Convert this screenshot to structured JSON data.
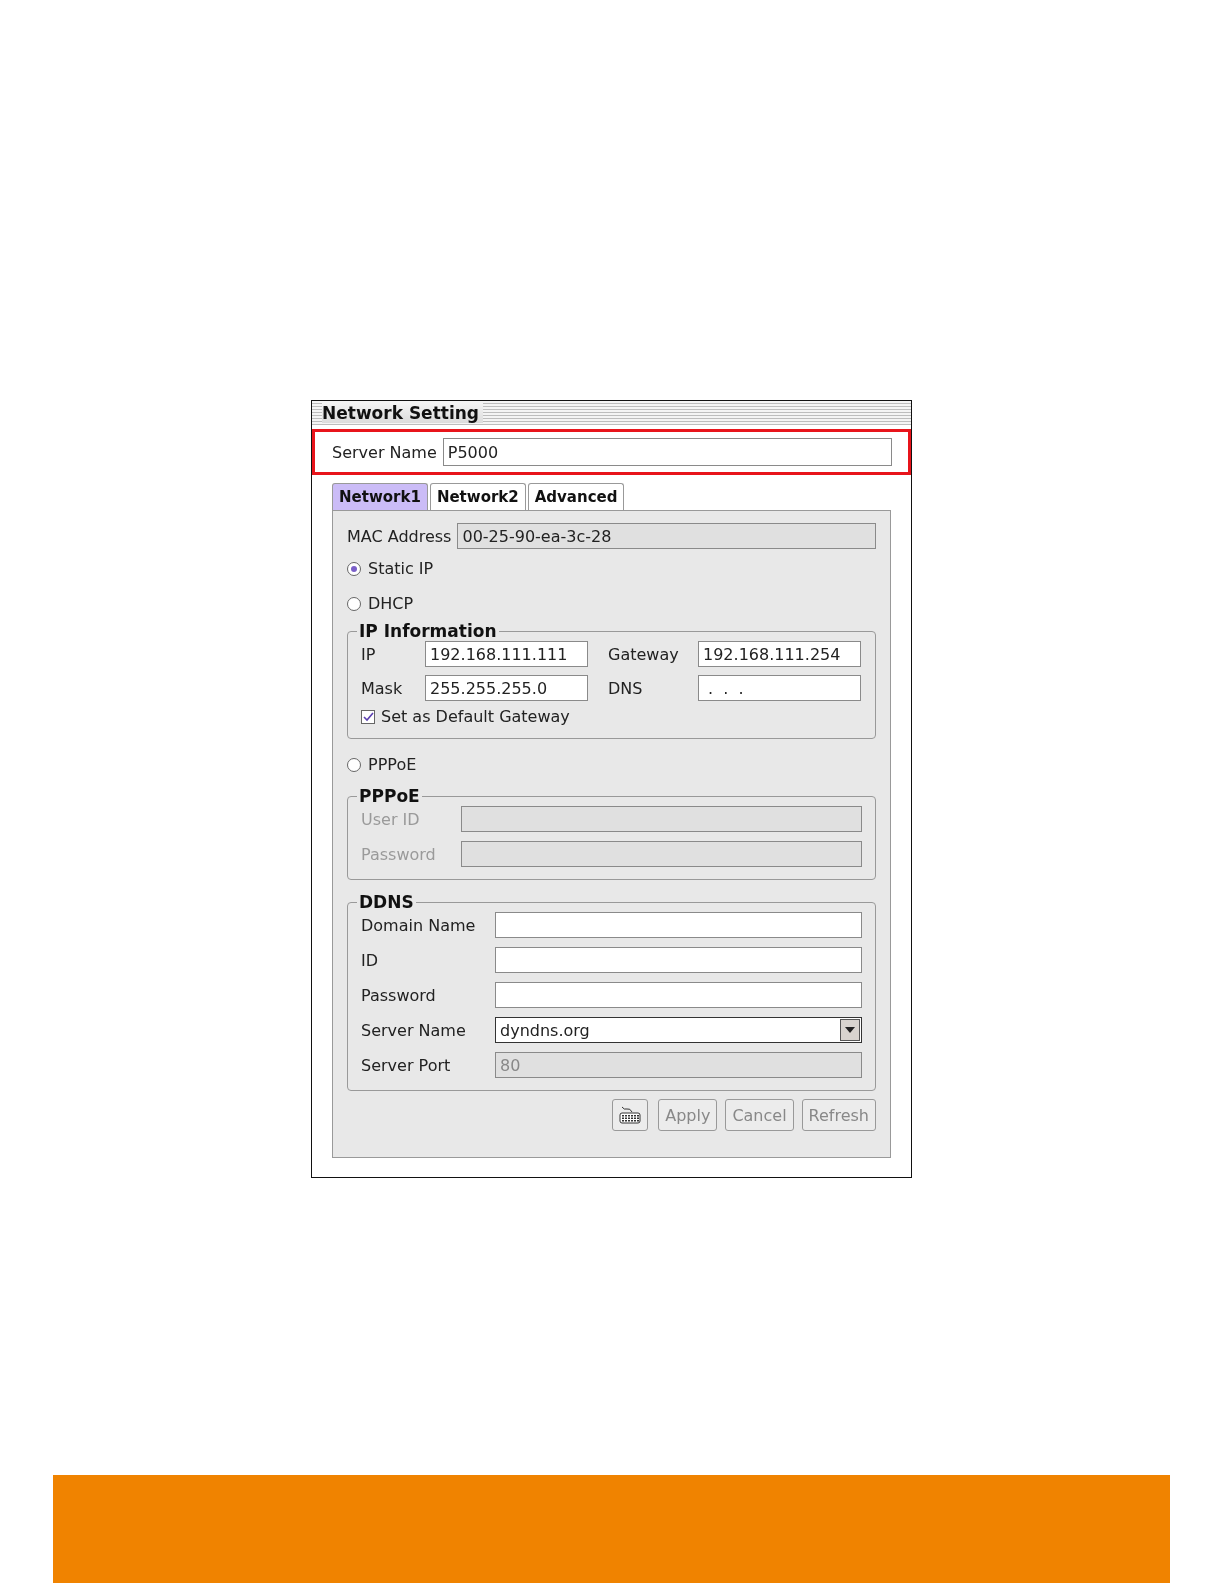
{
  "window": {
    "title": "Network Setting"
  },
  "server_name": {
    "label": "Server Name",
    "value": "P5000",
    "highlighted": true
  },
  "tabs": [
    {
      "label": "Network1",
      "selected": true
    },
    {
      "label": "Network2",
      "selected": false
    },
    {
      "label": "Advanced",
      "selected": false
    }
  ],
  "mac_address": {
    "label": "MAC Address",
    "value": "00-25-90-ea-3c-28"
  },
  "items": [
    {
      "kind": "radio",
      "label": "Static IP",
      "selected": true
    },
    {
      "kind": "radio",
      "label": "DHCP",
      "selected": false
    },
    {
      "kind": "ipgroup",
      "title": "IP Information",
      "fields": [
        {
          "label": "IP",
          "value": "192.168.111.111"
        },
        {
          "label": "Gateway",
          "value": "192.168.111.254"
        },
        {
          "label": "Mask",
          "value": "255.255.255.0"
        },
        {
          "label": "DNS",
          "value": " .  .  ."
        }
      ],
      "checkbox": {
        "label": "Set as Default Gateway",
        "checked": true
      }
    },
    {
      "kind": "radio",
      "label": "PPPoE",
      "selected": false
    },
    {
      "kind": "group",
      "title": "PPPoE",
      "fields": [
        {
          "kind": "text",
          "label": "User ID",
          "disabled": true
        },
        {
          "kind": "text",
          "label": "Password",
          "disabled": true
        }
      ]
    },
    {
      "kind": "group",
      "title": "DDNS",
      "fields": [
        {
          "kind": "text",
          "label": "Domain Name",
          "disabled": false
        },
        {
          "kind": "text",
          "label": "ID",
          "disabled": false
        },
        {
          "kind": "text",
          "label": "Password",
          "disabled": false
        },
        {
          "kind": "select",
          "label": "Server Name",
          "value": "dyndns.org",
          "disabled": false
        },
        {
          "kind": "text",
          "label": "Server Port",
          "value": "80",
          "disabled": true
        }
      ]
    }
  ],
  "buttons": [
    {
      "kind": "keyboard"
    },
    {
      "kind": "text",
      "label": "Apply",
      "disabled": true
    },
    {
      "kind": "text",
      "label": "Cancel",
      "disabled": true
    },
    {
      "kind": "text",
      "label": "Refresh",
      "disabled": true
    }
  ]
}
